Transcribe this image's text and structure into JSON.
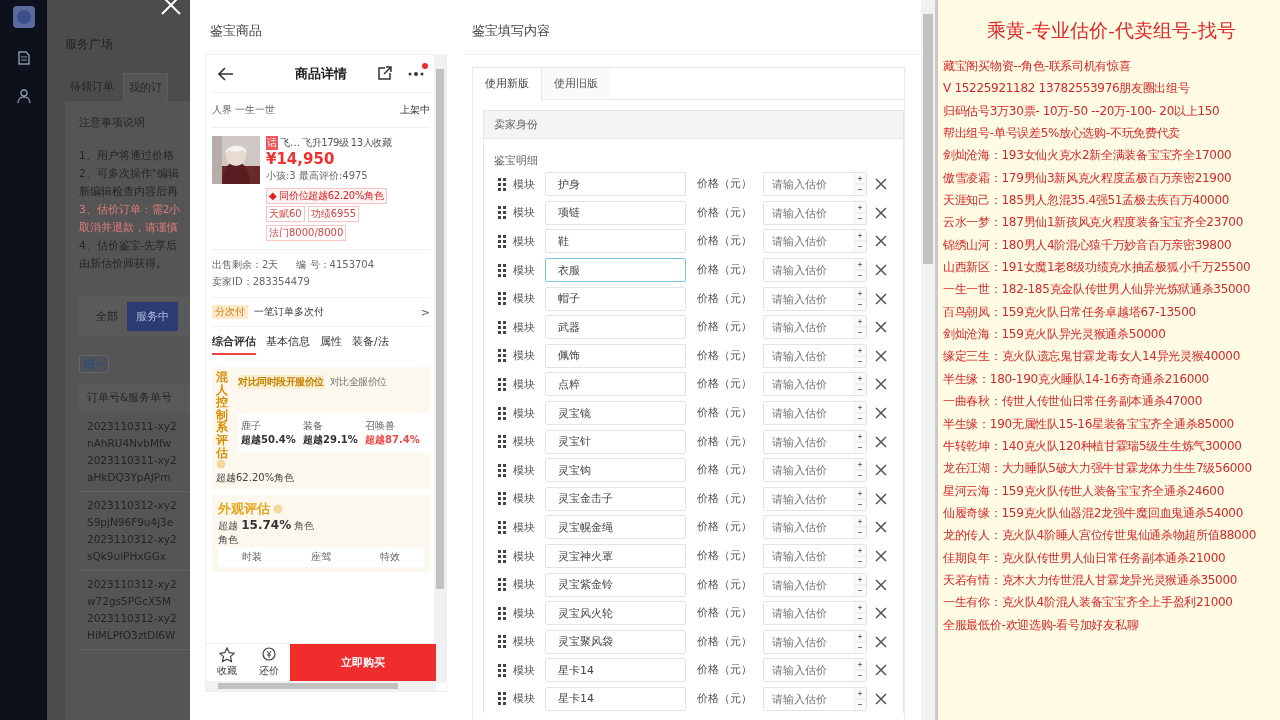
{
  "background_page": {
    "page_title": "服务广场",
    "tabs": [
      {
        "label": "待领订单",
        "selected": false
      },
      {
        "label": "我的订",
        "selected": true
      }
    ],
    "notice": {
      "title": "注意事项说明",
      "lines": [
        {
          "text": "1、用户将通过价格",
          "kind": "normal"
        },
        {
          "text": "2、可多次操作\"编辑",
          "kind": "normal"
        },
        {
          "text": "新编辑检查内容后再",
          "kind": "normal"
        },
        {
          "text": "3、估价订单：需2小",
          "kind": "warning"
        },
        {
          "text": "取消并退款，请谨慎",
          "kind": "warning"
        },
        {
          "text": "4、估价鉴宝-先享后",
          "kind": "normal"
        },
        {
          "text": "由新估价师获得。",
          "kind": "normal"
        }
      ]
    },
    "filters": [
      {
        "label": "全部",
        "selected": false
      },
      {
        "label": "服务中",
        "selected": true
      }
    ],
    "table_header": "订单号&服务单号",
    "orders": [
      {
        "lines": [
          "2023110311-xy2",
          "nAhRU4NvbMfw",
          "2023110311-xy2",
          "aHkDQ3YpAJPm"
        ]
      },
      {
        "lines": [
          "2023110312-xy2",
          "S9pjN96F9u4j3e",
          "2023110312-xy2",
          "sQk9uiPHxGGx"
        ]
      },
      {
        "lines": [
          "2023110312-xy2",
          "w72gs5PGcX5M",
          "2023110312-xy2",
          "HiMLPfO3ztDl6W"
        ]
      }
    ]
  },
  "modal": {
    "left_title": "鉴宝商品",
    "phone": {
      "title": "商品详情",
      "notification": true,
      "region": "人界 一生一世",
      "status": "上架中",
      "badge": "话",
      "name": "飞…",
      "level": "飞升179级",
      "favorites": "13人收藏",
      "price": "¥14,950",
      "stats": "小孩:3 最高评价:4975",
      "rank_tag": "◆ 同价位超越62.20%角色",
      "tags": [
        "天赋60",
        "功绩6955",
        "法门8000/8000"
      ],
      "remaining": "出售剩余：2天",
      "code": "编 号：4153704",
      "seller": "卖家ID：283354479",
      "installment": {
        "badge": "分次付",
        "text": "一笔订单多次付",
        "arrow": ">"
      },
      "tabs": [
        {
          "label": "综合评估",
          "selected": true
        },
        {
          "label": "基本信息",
          "selected": false
        },
        {
          "label": "属性",
          "selected": false
        },
        {
          "label": "装备/法",
          "selected": false
        }
      ],
      "evaluation": {
        "title": "混人控制系评估",
        "compare_tabs": [
          {
            "label": "对比同时段开服价位",
            "selected": true
          },
          {
            "label": "对比全服价位",
            "selected": false
          }
        ],
        "stats": [
          {
            "name": "鹿子",
            "value": "超越50.4%",
            "highlight": false
          },
          {
            "name": "装备",
            "value": "超越29.1%",
            "highlight": false
          },
          {
            "name": "召唤兽",
            "value": "超越87.4%",
            "highlight": true
          }
        ],
        "overall": "超越62.20%角色"
      },
      "appearance": {
        "title": "外观评估",
        "summary": "超越 **15.74%** 角色",
        "extra": "角色",
        "columns": [
          "时装",
          "座驾",
          "特效"
        ]
      },
      "actions": [
        {
          "label": "收藏",
          "kind": "star"
        },
        {
          "label": "还价",
          "kind": "bargain"
        }
      ],
      "buy": "立即购买"
    },
    "right_title": "鉴宝填写内容",
    "tabs": [
      {
        "label": "使用新版",
        "selected": true
      },
      {
        "label": "使用旧版",
        "selected": false
      }
    ],
    "section": "卖家身份",
    "detail_label": "鉴宝明细",
    "rows": [
      {
        "label": "模块",
        "value": "护身",
        "price_label": "价格（元）",
        "placeholder": "请输入估价",
        "focused": false
      },
      {
        "label": "模块",
        "value": "项链",
        "price_label": "价格（元）",
        "placeholder": "请输入估价",
        "focused": false
      },
      {
        "label": "模块",
        "value": "鞋",
        "price_label": "价格（元）",
        "placeholder": "请输入估价",
        "focused": false
      },
      {
        "label": "模块",
        "value": "衣服",
        "price_label": "价格（元）",
        "placeholder": "请输入估价",
        "focused": true
      },
      {
        "label": "模块",
        "value": "帽子",
        "price_label": "价格（元）",
        "placeholder": "请输入估价",
        "focused": false
      },
      {
        "label": "模块",
        "value": "武器",
        "price_label": "价格（元）",
        "placeholder": "请输入估价",
        "focused": false
      },
      {
        "label": "模块",
        "value": "佩饰",
        "price_label": "价格（元）",
        "placeholder": "请输入估价",
        "focused": false
      },
      {
        "label": "模块",
        "value": "点粹",
        "price_label": "价格（元）",
        "placeholder": "请输入估价",
        "focused": false
      },
      {
        "label": "模块",
        "value": "灵宝镜",
        "price_label": "价格（元）",
        "placeholder": "请输入估价",
        "focused": false
      },
      {
        "label": "模块",
        "value": "灵宝针",
        "price_label": "价格（元）",
        "placeholder": "请输入估价",
        "focused": false
      },
      {
        "label": "模块",
        "value": "灵宝钩",
        "price_label": "价格（元）",
        "placeholder": "请输入估价",
        "focused": false
      },
      {
        "label": "模块",
        "value": "灵宝金击子",
        "price_label": "价格（元）",
        "placeholder": "请输入估价",
        "focused": false
      },
      {
        "label": "模块",
        "value": "灵宝幌金绳",
        "price_label": "价格（元）",
        "placeholder": "请输入估价",
        "focused": false
      },
      {
        "label": "模块",
        "value": "灵宝神火罩",
        "price_label": "价格（元）",
        "placeholder": "请输入估价",
        "focused": false
      },
      {
        "label": "模块",
        "value": "灵宝紫金铃",
        "price_label": "价格（元）",
        "placeholder": "请输入估价",
        "focused": false
      },
      {
        "label": "模块",
        "value": "灵宝风火轮",
        "price_label": "价格（元）",
        "placeholder": "请输入估价",
        "focused": false
      },
      {
        "label": "模块",
        "value": "灵宝聚风袋",
        "price_label": "价格（元）",
        "placeholder": "请输入估价",
        "focused": false
      },
      {
        "label": "模块",
        "value": "星卡14",
        "price_label": "价格（元）",
        "placeholder": "请输入估价",
        "focused": false
      },
      {
        "label": "模块",
        "value": "星卡14",
        "price_label": "价格（元）",
        "placeholder": "请输入估价",
        "focused": false
      }
    ]
  },
  "notice_panel": {
    "title": "乘黄-专业估价-代卖组号-找号",
    "lines": [
      "藏宝阁买物资--角色-联系司机有惊喜",
      "V 15225921182  13782553976朋友圈出组号",
      "归码估号3万30票- 10万-50 --20万-100- 20以上150",
      "帮出组号-单号误差5%放心选购-不玩免费代卖",
      "剑灿沧海：193女仙火克水2新全满装备宝宝齐全17000",
      "傲雪凌霜：179男仙3新风克火程度孟极百万亲密21900",
      "天涯知己：185男人忽混35.4强51孟极去疾百万40000",
      "云水一梦：187男仙1新孩风克火程度装备宝宝齐全23700",
      "锦绣山河：180男人4阶混心猿千万妙音百万亲密39800",
      "山西新区：191女魔1老8级功绩克水抽孟极狐小千万25500",
      "一生一世：182-185克金队传世男人仙异光炼狱通杀35000",
      "百鸟朝凤：159克火队日常任务卓越塔67-13500",
      "剑灿沧海：159克火队异光灵猴通杀50000",
      "缘定三生：克火队遗忘鬼甘霖龙毒女人14异光灵猴40000",
      "半生缘：180-190克火睡队14-16夯奇通杀216000",
      "一曲春秋：传世人传世仙日常任务副本通杀47000",
      "半生缘：190无属性队15-16星装备宝宝齐全通杀85000",
      "牛转乾坤：140克火队120种植甘霖瑞5级生生炼气30000",
      "龙在江湖：大力睡队5破大力强牛甘霖龙体力生生7级56000",
      "星河云海：159克火队传世人装备宝宝齐全通杀24600",
      "仙履奇缘：159克火队仙器混2龙强牛魔回血鬼通杀54000",
      "龙的传人：克火队4阶睡人宫位传世鬼仙通杀物超所值88000",
      "佳期良年：克火队传世男人仙日常任务副本通杀21000",
      "天若有情：克木大力传世混人甘霖龙异光灵猴通杀35000",
      "一生有你：克火队4阶混人装备宝宝齐全上手盈利21000",
      "全服最低价-欢迎选购-看号加好友私聊"
    ]
  }
}
